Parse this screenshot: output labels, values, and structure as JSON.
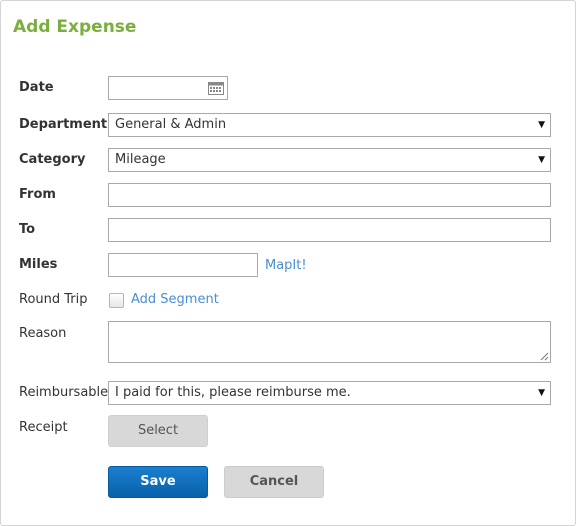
{
  "dialog": {
    "title": "Add Expense"
  },
  "form": {
    "date": {
      "label": "Date",
      "value": "",
      "icon": "calendar-icon"
    },
    "department": {
      "label": "Department",
      "value": "General & Admin"
    },
    "category": {
      "label": "Category",
      "value": "Mileage"
    },
    "from": {
      "label": "From",
      "value": ""
    },
    "to": {
      "label": "To",
      "value": ""
    },
    "miles": {
      "label": "Miles",
      "value": "",
      "mapit_link": "MapIt!"
    },
    "round_trip": {
      "label": "Round Trip",
      "checked": false,
      "add_segment_link": "Add Segment"
    },
    "reason": {
      "label": "Reason",
      "value": ""
    },
    "reimbursable": {
      "label": "Reimbursable",
      "value": "I paid for this, please reimburse me."
    },
    "receipt": {
      "label": "Receipt",
      "select_button": "Select"
    }
  },
  "actions": {
    "save_label": "Save",
    "cancel_label": "Cancel"
  },
  "colors": {
    "title": "#7cae3f",
    "link": "#4a8fd1",
    "primary_button": "#0a6ebd",
    "secondary_button": "#d8d8d8"
  }
}
